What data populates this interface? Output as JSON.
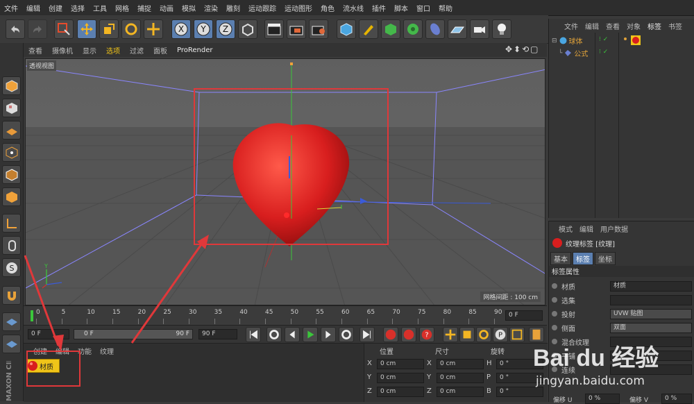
{
  "menu": [
    "文件",
    "编辑",
    "创建",
    "选择",
    "工具",
    "网格",
    "捕捉",
    "动画",
    "模拟",
    "渲染",
    "雕刻",
    "运动跟踪",
    "运动图形",
    "角色",
    "流水线",
    "插件",
    "脚本",
    "窗口",
    "帮助"
  ],
  "viewport_menu": [
    "查看",
    "摄像机",
    "显示",
    "选项",
    "过滤",
    "面板",
    "ProRender"
  ],
  "viewport": {
    "name": "透视视图",
    "grid_spacing": "网格间距 : 100 cm"
  },
  "timeline": {
    "ticks": [
      "0",
      "5",
      "10",
      "15",
      "20",
      "25",
      "30",
      "35",
      "40",
      "45",
      "50",
      "55",
      "60",
      "65",
      "70",
      "75",
      "80",
      "85",
      "90"
    ],
    "frame_field": "0 F"
  },
  "transport": {
    "start": "0 F",
    "slider_left": "0 F",
    "slider_right": "90 F",
    "end": "90 F"
  },
  "material_manager": {
    "menu": [
      "创建",
      "编辑",
      "功能",
      "纹理"
    ],
    "material_name": "材质"
  },
  "coords": {
    "headers": [
      "位置",
      "尺寸",
      "旋转"
    ],
    "rows": [
      {
        "a": "X",
        "av": "0 cm",
        "b": "X",
        "bv": "0 cm",
        "c": "H",
        "cv": "0 °"
      },
      {
        "a": "Y",
        "av": "0 cm",
        "b": "Y",
        "bv": "0 cm",
        "c": "P",
        "cv": "0 °"
      },
      {
        "a": "Z",
        "av": "0 cm",
        "b": "Z",
        "bv": "0 cm",
        "c": "B",
        "cv": "0 °"
      }
    ]
  },
  "object_manager": {
    "menu": [
      "文件",
      "编辑",
      "查看",
      "对象",
      "标签",
      "书签"
    ],
    "objects": [
      {
        "name": "球体"
      },
      {
        "name": "公式"
      }
    ]
  },
  "attributes": {
    "menu": [
      "模式",
      "编辑",
      "用户数据"
    ],
    "title": "纹理标签 [纹理]",
    "tabs": [
      "基本",
      "标签",
      "坐标"
    ],
    "section": "标签属性",
    "rows": [
      {
        "label": "材质",
        "value": "材质"
      },
      {
        "label": "选集",
        "value": ""
      },
      {
        "label": "投射",
        "value": "UVW 贴图"
      },
      {
        "label": "侧面",
        "value": "双面"
      },
      {
        "label": "混合纹理",
        "value": ""
      },
      {
        "label": "平铺",
        "value": ""
      },
      {
        "label": "连续",
        "value": ""
      }
    ],
    "offset_u_label": "偏移 U",
    "offset_u": "0 %",
    "offset_v_label": "偏移 V",
    "offset_v": "0 %"
  },
  "side_brand": "MAXON CINEMA 4D",
  "watermark": {
    "logo": "Bai du 经验",
    "url": "jingyan.baidu.com"
  },
  "colors": {
    "accent": "#e0383a",
    "heart": "#d81e1e",
    "menu_active": "#f0c419"
  }
}
